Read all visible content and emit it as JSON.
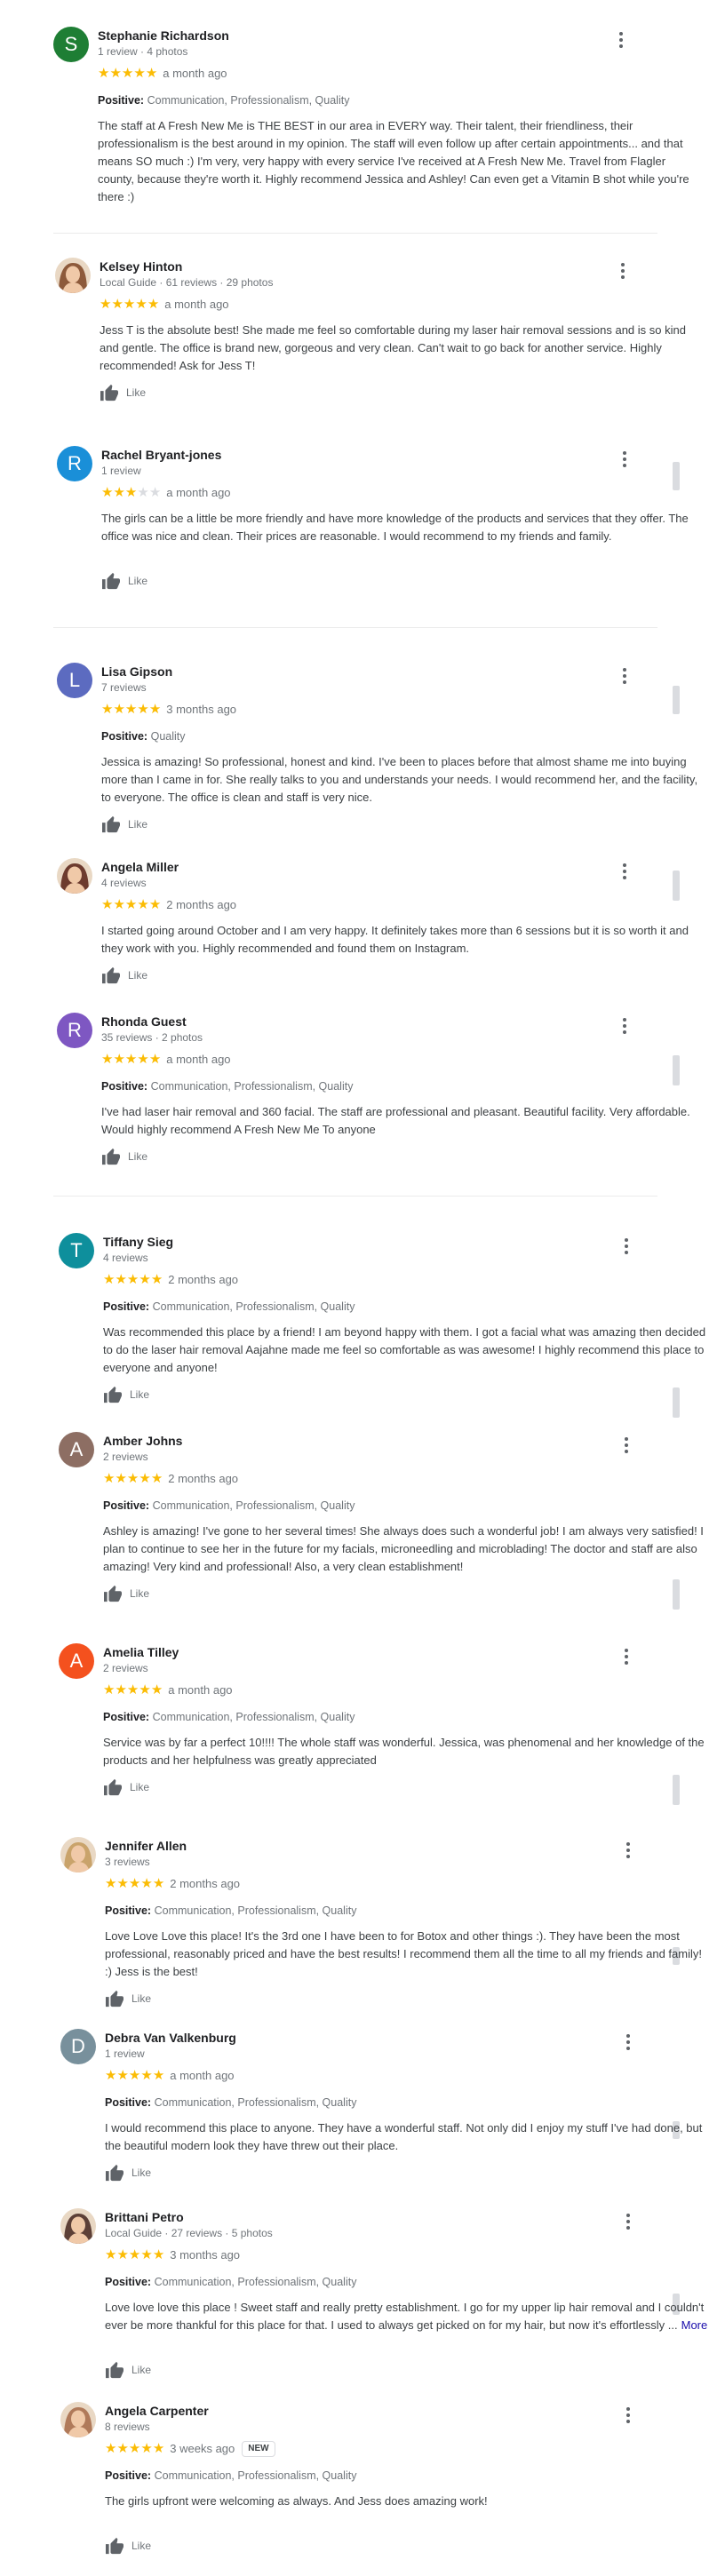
{
  "ui": {
    "like_label": "Like",
    "positive_label": "Positive:",
    "more_label": "More",
    "new_badge": "NEW",
    "star_color": "#fbbc04",
    "star_empty_color": "#dadce0",
    "icons": {
      "like": "thumbs-up-icon",
      "menu": "more-vert-icon",
      "star": "star-icon"
    }
  },
  "reviews": [
    {
      "name": "Stephanie Richardson",
      "meta": "1 review · 4 photos",
      "rating": 5,
      "date": "a month ago",
      "avatar": {
        "type": "letter",
        "letter": "S",
        "color": "#1e7e34"
      },
      "positive": "Communication, Professionalism, Quality",
      "text": "The staff at A Fresh New Me is THE BEST in our area in EVERY way. Their talent, their friendliness, their professionalism is the best around in my opinion. The staff will even follow up after certain appointments... and that means SO much :) I'm very, very happy with every service I've received at A Fresh New Me. Travel from Flagler county, because they're worth it. Highly recommend Jessica and Ashley! Can even get a Vitamin B shot while you're there :)",
      "like": false
    },
    {
      "name": "Kelsey Hinton",
      "meta": "Local Guide · 61 reviews · 29 photos",
      "rating": 5,
      "date": "a month ago",
      "avatar": {
        "type": "photo",
        "color": "#8d5a3b"
      },
      "positive": "",
      "text": "Jess T is the absolute best! She made me feel so comfortable during my laser hair removal sessions and is so kind and gentle. The office is brand new, gorgeous and very clean. Can't wait to go back for another service. Highly recommended! Ask for Jess T!",
      "like": true
    },
    {
      "name": "Rachel Bryant-jones",
      "meta": "1 review",
      "rating": 3,
      "date": "a month ago",
      "avatar": {
        "type": "letter",
        "letter": "R",
        "color": "#1a8fd8"
      },
      "positive": "",
      "text": "The girls can be a little be more friendly and have more knowledge of the products and services that they offer. The office was nice and clean. Their prices are reasonable. I would recommend to my friends and family.",
      "like": true
    },
    {
      "name": "Lisa Gipson",
      "meta": "7 reviews",
      "rating": 5,
      "date": "3 months ago",
      "avatar": {
        "type": "letter",
        "letter": "L",
        "color": "#5c6bc0"
      },
      "positive": "Quality",
      "text": "Jessica is amazing! So professional, honest and kind. I've been to places before that almost shame me into buying more than I came in for. She really talks to you and understands your needs. I would recommend her, and the facility, to everyone. The office is clean and staff is very nice.",
      "like": true
    },
    {
      "name": "Angela Miller",
      "meta": "4 reviews",
      "rating": 5,
      "date": "2 months ago",
      "avatar": {
        "type": "photo",
        "color": "#6d3b2e"
      },
      "positive": "",
      "text": "I started going around October and I am very happy. It definitely takes more than 6 sessions but it is so worth it and they work with you. Highly recommended and found them on Instagram.",
      "like": true
    },
    {
      "name": "Rhonda Guest",
      "meta": "35 reviews · 2 photos",
      "rating": 5,
      "date": "a month ago",
      "avatar": {
        "type": "letter",
        "letter": "R",
        "color": "#7e57c2"
      },
      "positive": "Communication, Professionalism, Quality",
      "text": "I've had laser hair removal and 360 facial. The staff are professional and pleasant. Beautiful facility. Very affordable. Would highly recommend A Fresh New Me To anyone",
      "like": true
    },
    {
      "name": "Tiffany Sieg",
      "meta": "4 reviews",
      "rating": 5,
      "date": "2 months ago",
      "avatar": {
        "type": "letter",
        "letter": "T",
        "color": "#0e8f9c"
      },
      "positive": "Communication, Professionalism, Quality",
      "text": "Was recommended this place by a friend! I am beyond happy with them. I got a facial what was amazing then decided to do the laser hair removal Aajahne made me feel so comfortable as was awesome! I highly recommend this place to everyone and anyone!",
      "like": true
    },
    {
      "name": "Amber Johns",
      "meta": "2 reviews",
      "rating": 5,
      "date": "2 months ago",
      "avatar": {
        "type": "letter",
        "letter": "A",
        "color": "#8d6e63"
      },
      "positive": "Communication, Professionalism, Quality",
      "text": "Ashley is amazing! I've gone to her several times! She always does such a wonderful job! I am always very satisfied! I plan to continue to see her in the future for my facials, microneedling and microblading! The doctor and staff are also amazing! Very kind and professional! Also, a very clean establishment!",
      "like": true
    },
    {
      "name": "Amelia Tilley",
      "meta": "2 reviews",
      "rating": 5,
      "date": "a month ago",
      "avatar": {
        "type": "letter",
        "letter": "A",
        "color": "#f4511e"
      },
      "positive": "Communication, Professionalism, Quality",
      "text": "Service was by far a perfect 10!!!! The whole staff was wonderful. Jessica, was phenomenal and her knowledge of the products and her helpfulness was greatly appreciated",
      "like": true
    },
    {
      "name": "Jennifer Allen",
      "meta": "3 reviews",
      "rating": 5,
      "date": "2 months ago",
      "avatar": {
        "type": "photo",
        "color": "#c9a36b"
      },
      "positive": "Communication, Professionalism, Quality",
      "text": "Love Love Love this place! It's the 3rd one I have been to for Botox and other things :). They have been the most professional, reasonably priced and have the best results! I recommend them all the time to all my friends and family! :) Jess is the best!",
      "like": true
    },
    {
      "name": "Debra Van Valkenburg",
      "meta": "1 review",
      "rating": 5,
      "date": "a month ago",
      "avatar": {
        "type": "letter",
        "letter": "D",
        "color": "#78909c"
      },
      "positive": "Communication, Professionalism, Quality",
      "text": "I would recommend this place to anyone. They have a wonderful staff. Not only did I enjoy my stuff I've had done, but the beautiful modern look they have threw out their place.",
      "like": true
    },
    {
      "name": "Brittani Petro",
      "meta": "Local Guide · 27 reviews · 5 photos",
      "rating": 5,
      "date": "3 months ago",
      "avatar": {
        "type": "photo",
        "color": "#5d4037"
      },
      "positive": "Communication, Professionalism, Quality",
      "text": "Love love love this place ! Sweet staff and really pretty establishment. I go for my upper lip hair removal and I couldn't ever be more thankful for this place for that. I used to always get picked on for my hair, but now it's effortlessly ...",
      "more": true,
      "like": true
    },
    {
      "name": "Angela Carpenter",
      "meta": "8 reviews",
      "rating": 5,
      "date": "3 weeks ago",
      "is_new": true,
      "avatar": {
        "type": "photo",
        "color": "#b07a5a"
      },
      "positive": "Communication, Professionalism, Quality",
      "text": "The girls upfront were welcoming as always. And Jess does amazing work!",
      "like": true
    }
  ]
}
